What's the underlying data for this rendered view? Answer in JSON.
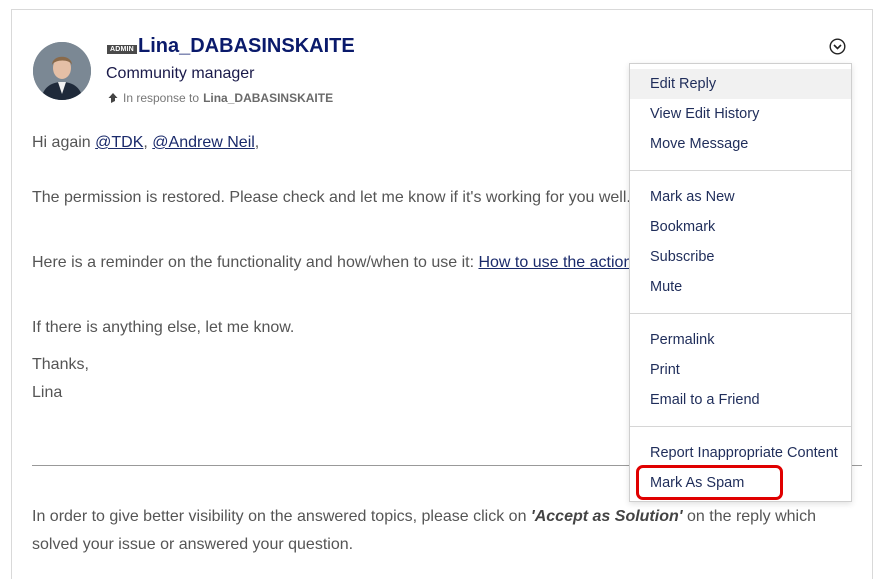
{
  "post": {
    "author": {
      "badge": "ADMIN",
      "username": "Lina_DABASINSKAITE",
      "rank": "Community manager"
    },
    "in_response": {
      "prefix": "In response to",
      "user": "Lina_DABASINSKAITE"
    },
    "body": {
      "greeting_prefix": "Hi again ",
      "mention1": "@TDK",
      "sep": ", ",
      "mention2": "@Andrew Neil",
      "greeting_suffix": ",",
      "line2": "The permission is restored. Please check and let me know if it's working for you well.",
      "line3_prefix": "Here is a reminder on the functionality and how/when to use it: ",
      "line3_link": "How to use the action",
      "line4": "If there is anything else, let me know.",
      "thanks": "Thanks,",
      "signature": "Lina"
    },
    "footer": {
      "part1": "In order to give better visibility on the answered topics, please click on ",
      "emphasis": "'Accept as Solution'",
      "part2": " on the reply which",
      "line2": "solved your issue or answered your question."
    }
  },
  "menu": {
    "group1": [
      "Edit Reply",
      "View Edit History",
      "Move Message"
    ],
    "group2": [
      "Mark as New",
      "Bookmark",
      "Subscribe",
      "Mute"
    ],
    "group3": [
      "Permalink",
      "Print",
      "Email to a Friend"
    ],
    "group4": [
      "Report Inappropriate Content",
      "Mark As Spam"
    ]
  },
  "colors": {
    "highlight_box": "#e00000",
    "username": "#0a1a6b",
    "menu_text": "#1f2d5a"
  },
  "icons": {
    "options": "chevron-down-circle-icon",
    "reply_arrow": "arrow-up-icon"
  }
}
